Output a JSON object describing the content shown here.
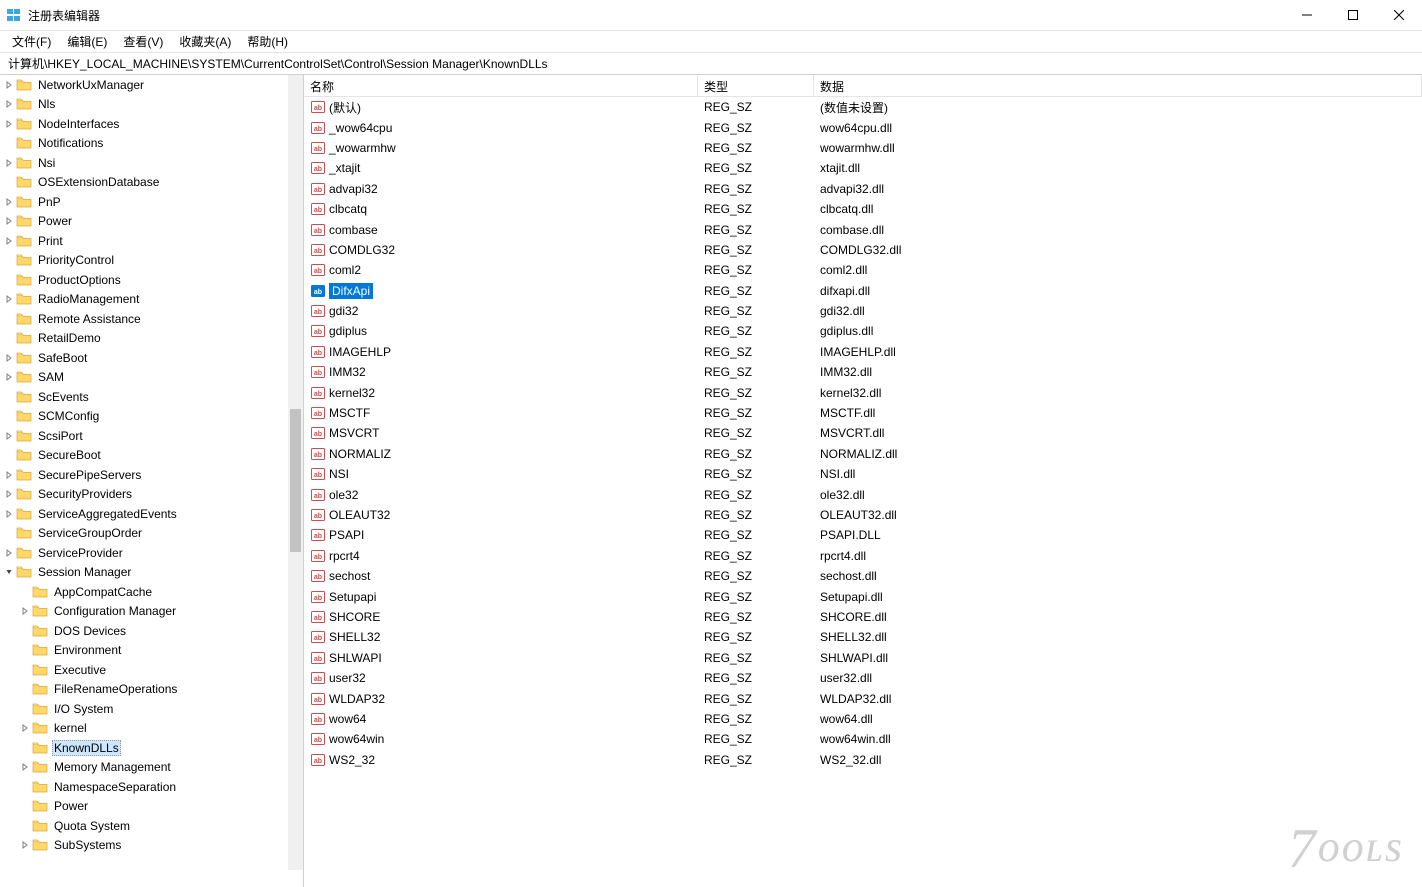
{
  "window": {
    "title": "注册表编辑器"
  },
  "menu": [
    "文件(F)",
    "编辑(E)",
    "查看(V)",
    "收藏夹(A)",
    "帮助(H)"
  ],
  "address": "计算机\\HKEY_LOCAL_MACHINE\\SYSTEM\\CurrentControlSet\\Control\\Session Manager\\KnownDLLs",
  "columns": {
    "name": "名称",
    "type": "类型",
    "data": "数据"
  },
  "default_value_label": "(默认)",
  "unset_value_label": "(数值未设置)",
  "tree": [
    {
      "depth": 5,
      "label": "NetworkUxManager",
      "hasChev": true,
      "expanded": false
    },
    {
      "depth": 5,
      "label": "Nls",
      "hasChev": true,
      "expanded": false
    },
    {
      "depth": 5,
      "label": "NodeInterfaces",
      "hasChev": true,
      "expanded": false
    },
    {
      "depth": 5,
      "label": "Notifications",
      "hasChev": false
    },
    {
      "depth": 5,
      "label": "Nsi",
      "hasChev": true,
      "expanded": false
    },
    {
      "depth": 5,
      "label": "OSExtensionDatabase",
      "hasChev": false
    },
    {
      "depth": 5,
      "label": "PnP",
      "hasChev": true,
      "expanded": false
    },
    {
      "depth": 5,
      "label": "Power",
      "hasChev": true,
      "expanded": false
    },
    {
      "depth": 5,
      "label": "Print",
      "hasChev": true,
      "expanded": false
    },
    {
      "depth": 5,
      "label": "PriorityControl",
      "hasChev": false
    },
    {
      "depth": 5,
      "label": "ProductOptions",
      "hasChev": false
    },
    {
      "depth": 5,
      "label": "RadioManagement",
      "hasChev": true,
      "expanded": false
    },
    {
      "depth": 5,
      "label": "Remote Assistance",
      "hasChev": false
    },
    {
      "depth": 5,
      "label": "RetailDemo",
      "hasChev": false
    },
    {
      "depth": 5,
      "label": "SafeBoot",
      "hasChev": true,
      "expanded": false
    },
    {
      "depth": 5,
      "label": "SAM",
      "hasChev": true,
      "expanded": false
    },
    {
      "depth": 5,
      "label": "ScEvents",
      "hasChev": false
    },
    {
      "depth": 5,
      "label": "SCMConfig",
      "hasChev": false
    },
    {
      "depth": 5,
      "label": "ScsiPort",
      "hasChev": true,
      "expanded": false
    },
    {
      "depth": 5,
      "label": "SecureBoot",
      "hasChev": false
    },
    {
      "depth": 5,
      "label": "SecurePipeServers",
      "hasChev": true,
      "expanded": false
    },
    {
      "depth": 5,
      "label": "SecurityProviders",
      "hasChev": true,
      "expanded": false
    },
    {
      "depth": 5,
      "label": "ServiceAggregatedEvents",
      "hasChev": true,
      "expanded": false
    },
    {
      "depth": 5,
      "label": "ServiceGroupOrder",
      "hasChev": false
    },
    {
      "depth": 5,
      "label": "ServiceProvider",
      "hasChev": true,
      "expanded": false
    },
    {
      "depth": 5,
      "label": "Session Manager",
      "hasChev": true,
      "expanded": true
    },
    {
      "depth": 6,
      "label": "AppCompatCache",
      "hasChev": false
    },
    {
      "depth": 6,
      "label": "Configuration Manager",
      "hasChev": true,
      "expanded": false
    },
    {
      "depth": 6,
      "label": "DOS Devices",
      "hasChev": false
    },
    {
      "depth": 6,
      "label": "Environment",
      "hasChev": false
    },
    {
      "depth": 6,
      "label": "Executive",
      "hasChev": false
    },
    {
      "depth": 6,
      "label": "FileRenameOperations",
      "hasChev": false
    },
    {
      "depth": 6,
      "label": "I/O System",
      "hasChev": false
    },
    {
      "depth": 6,
      "label": "kernel",
      "hasChev": true,
      "expanded": false
    },
    {
      "depth": 6,
      "label": "KnownDLLs",
      "hasChev": false,
      "selected": true
    },
    {
      "depth": 6,
      "label": "Memory Management",
      "hasChev": true,
      "expanded": false
    },
    {
      "depth": 6,
      "label": "NamespaceSeparation",
      "hasChev": false
    },
    {
      "depth": 6,
      "label": "Power",
      "hasChev": false
    },
    {
      "depth": 6,
      "label": "Quota System",
      "hasChev": false
    },
    {
      "depth": 6,
      "label": "SubSystems",
      "hasChev": true,
      "expanded": false
    }
  ],
  "values": [
    {
      "name": "(默认)",
      "type": "REG_SZ",
      "data": "(数值未设置)"
    },
    {
      "name": "_wow64cpu",
      "type": "REG_SZ",
      "data": "wow64cpu.dll"
    },
    {
      "name": "_wowarmhw",
      "type": "REG_SZ",
      "data": "wowarmhw.dll"
    },
    {
      "name": "_xtajit",
      "type": "REG_SZ",
      "data": "xtajit.dll"
    },
    {
      "name": "advapi32",
      "type": "REG_SZ",
      "data": "advapi32.dll"
    },
    {
      "name": "clbcatq",
      "type": "REG_SZ",
      "data": "clbcatq.dll"
    },
    {
      "name": "combase",
      "type": "REG_SZ",
      "data": "combase.dll"
    },
    {
      "name": "COMDLG32",
      "type": "REG_SZ",
      "data": "COMDLG32.dll"
    },
    {
      "name": "coml2",
      "type": "REG_SZ",
      "data": "coml2.dll"
    },
    {
      "name": "DifxApi",
      "type": "REG_SZ",
      "data": "difxapi.dll",
      "selected": true
    },
    {
      "name": "gdi32",
      "type": "REG_SZ",
      "data": "gdi32.dll"
    },
    {
      "name": "gdiplus",
      "type": "REG_SZ",
      "data": "gdiplus.dll"
    },
    {
      "name": "IMAGEHLP",
      "type": "REG_SZ",
      "data": "IMAGEHLP.dll"
    },
    {
      "name": "IMM32",
      "type": "REG_SZ",
      "data": "IMM32.dll"
    },
    {
      "name": "kernel32",
      "type": "REG_SZ",
      "data": "kernel32.dll"
    },
    {
      "name": "MSCTF",
      "type": "REG_SZ",
      "data": "MSCTF.dll"
    },
    {
      "name": "MSVCRT",
      "type": "REG_SZ",
      "data": "MSVCRT.dll"
    },
    {
      "name": "NORMALIZ",
      "type": "REG_SZ",
      "data": "NORMALIZ.dll"
    },
    {
      "name": "NSI",
      "type": "REG_SZ",
      "data": "NSI.dll"
    },
    {
      "name": "ole32",
      "type": "REG_SZ",
      "data": "ole32.dll"
    },
    {
      "name": "OLEAUT32",
      "type": "REG_SZ",
      "data": "OLEAUT32.dll"
    },
    {
      "name": "PSAPI",
      "type": "REG_SZ",
      "data": "PSAPI.DLL"
    },
    {
      "name": "rpcrt4",
      "type": "REG_SZ",
      "data": "rpcrt4.dll"
    },
    {
      "name": "sechost",
      "type": "REG_SZ",
      "data": "sechost.dll"
    },
    {
      "name": "Setupapi",
      "type": "REG_SZ",
      "data": "Setupapi.dll"
    },
    {
      "name": "SHCORE",
      "type": "REG_SZ",
      "data": "SHCORE.dll"
    },
    {
      "name": "SHELL32",
      "type": "REG_SZ",
      "data": "SHELL32.dll"
    },
    {
      "name": "SHLWAPI",
      "type": "REG_SZ",
      "data": "SHLWAPI.dll"
    },
    {
      "name": "user32",
      "type": "REG_SZ",
      "data": "user32.dll"
    },
    {
      "name": "WLDAP32",
      "type": "REG_SZ",
      "data": "WLDAP32.dll"
    },
    {
      "name": "wow64",
      "type": "REG_SZ",
      "data": "wow64.dll"
    },
    {
      "name": "wow64win",
      "type": "REG_SZ",
      "data": "wow64win.dll"
    },
    {
      "name": "WS2_32",
      "type": "REG_SZ",
      "data": "WS2_32.dll"
    }
  ],
  "watermark": "7ools"
}
